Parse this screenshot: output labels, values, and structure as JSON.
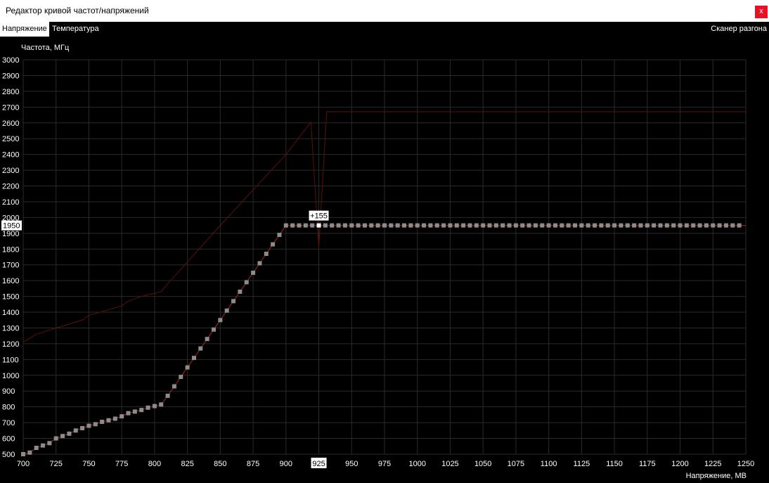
{
  "window": {
    "title": "Редактор кривой частот/напряжений",
    "close_label": "x"
  },
  "tabs": [
    {
      "label": "Напряжение",
      "active": true
    },
    {
      "label": "Температура",
      "active": false
    }
  ],
  "scanner_label": "Сканер разгона",
  "colors": {
    "background": "#000000",
    "grid": "#2a2a2a",
    "curve": "#b22020",
    "default_curve": "#5a1010",
    "point": "#8c8c8c",
    "selected_point": "#ffffff",
    "axis_text": "#ffffff"
  },
  "chart_data": {
    "type": "line",
    "ylabel": "Частота, МГц",
    "xlabel": "Напряжение, МВ",
    "xlim": [
      700,
      1250
    ],
    "ylim": [
      500,
      3000
    ],
    "x_ticks": [
      700,
      725,
      750,
      775,
      800,
      825,
      850,
      875,
      900,
      925,
      950,
      975,
      1000,
      1025,
      1050,
      1075,
      1100,
      1125,
      1150,
      1175,
      1200,
      1225,
      1250
    ],
    "y_ticks": [
      500,
      600,
      700,
      800,
      900,
      1000,
      1100,
      1200,
      1300,
      1400,
      1500,
      1600,
      1700,
      1800,
      1900,
      2000,
      2100,
      2200,
      2300,
      2400,
      2500,
      2600,
      2700,
      2800,
      2900,
      3000
    ],
    "selected": {
      "voltage": 925,
      "frequency": 1950,
      "offset_label": "+155",
      "x_label": "925",
      "y_label": "1950"
    },
    "default_curve": {
      "x": [
        700,
        710,
        725,
        745,
        750,
        775,
        780,
        790,
        805,
        810,
        850,
        900,
        919,
        925,
        928,
        931,
        1250
      ],
      "y": [
        1210,
        1260,
        1300,
        1350,
        1380,
        1440,
        1470,
        1500,
        1530,
        1580,
        1950,
        2400,
        2605,
        1810,
        2250,
        2670,
        2670
      ]
    },
    "series": [
      {
        "x": [
          700,
          705,
          710,
          715,
          720,
          725,
          730,
          735,
          740,
          745,
          750,
          755,
          760,
          765,
          770,
          775,
          780,
          785,
          790,
          795,
          800,
          805,
          810,
          815,
          820,
          825,
          830,
          835,
          840,
          845,
          850,
          855,
          860,
          865,
          870,
          875,
          880,
          885,
          890,
          895,
          900,
          905,
          910,
          915,
          920,
          925,
          930,
          935,
          940,
          945,
          950,
          955,
          960,
          965,
          970,
          975,
          980,
          985,
          990,
          995,
          1000,
          1005,
          1010,
          1015,
          1020,
          1025,
          1030,
          1035,
          1040,
          1045,
          1050,
          1055,
          1060,
          1065,
          1070,
          1075,
          1080,
          1085,
          1090,
          1095,
          1100,
          1105,
          1110,
          1115,
          1120,
          1125,
          1130,
          1135,
          1140,
          1145,
          1150,
          1155,
          1160,
          1165,
          1170,
          1175,
          1180,
          1185,
          1190,
          1195,
          1200,
          1205,
          1210,
          1215,
          1220,
          1225,
          1230,
          1235,
          1240,
          1245
        ],
        "y": [
          500,
          510,
          540,
          555,
          570,
          600,
          615,
          630,
          650,
          665,
          680,
          690,
          705,
          715,
          725,
          740,
          760,
          770,
          780,
          795,
          805,
          815,
          870,
          930,
          990,
          1050,
          1110,
          1170,
          1230,
          1290,
          1350,
          1410,
          1470,
          1530,
          1590,
          1650,
          1710,
          1770,
          1830,
          1890,
          1950,
          1950,
          1950,
          1950,
          1950,
          1950,
          1950,
          1950,
          1950,
          1950,
          1950,
          1950,
          1950,
          1950,
          1950,
          1950,
          1950,
          1950,
          1950,
          1950,
          1950,
          1950,
          1950,
          1950,
          1950,
          1950,
          1950,
          1950,
          1950,
          1950,
          1950,
          1950,
          1950,
          1950,
          1950,
          1950,
          1950,
          1950,
          1950,
          1950,
          1950,
          1950,
          1950,
          1950,
          1950,
          1950,
          1950,
          1950,
          1950,
          1950,
          1950,
          1950,
          1950,
          1950,
          1950,
          1950,
          1950,
          1950,
          1950,
          1950,
          1950,
          1950,
          1950,
          1950,
          1950,
          1950,
          1950,
          1950,
          1950,
          1950
        ]
      }
    ]
  }
}
